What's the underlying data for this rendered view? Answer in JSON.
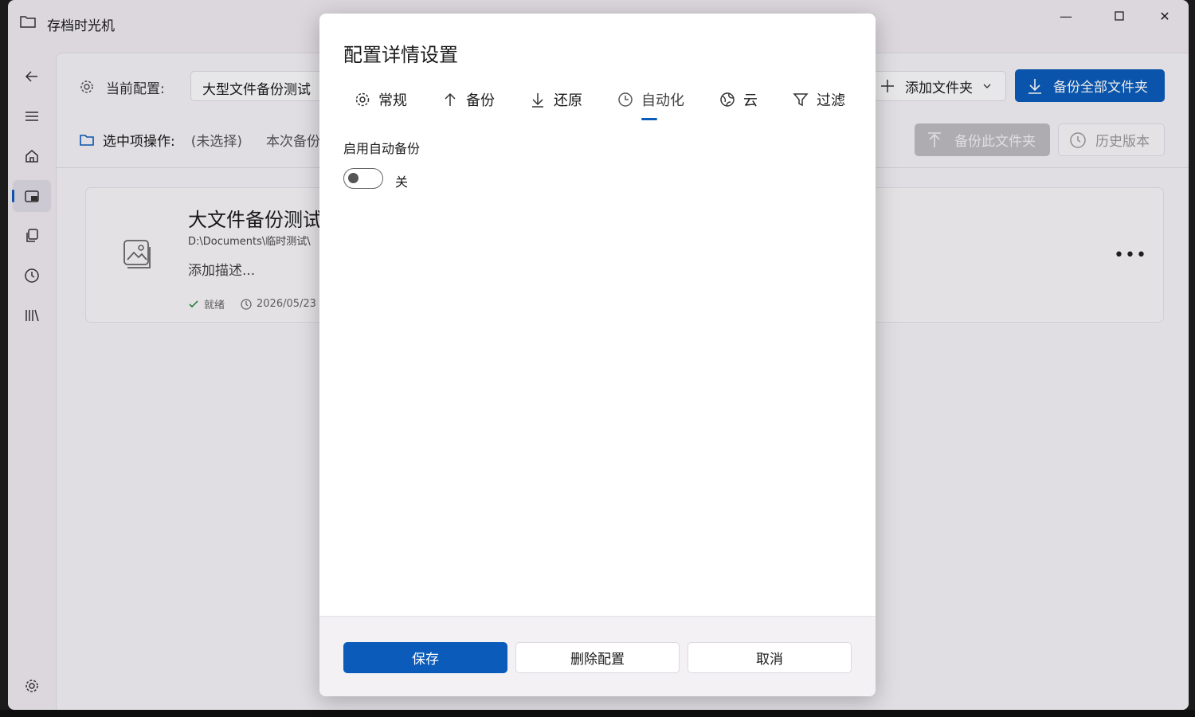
{
  "window": {
    "title": "存档时光机",
    "minimize_glyph": "—",
    "maximize_glyph": "☐",
    "close_glyph": "✕"
  },
  "toolbar": {
    "current_config_label": "当前配置:",
    "current_config_value": "大型文件备份测试",
    "add_folder_label": "添加文件夹",
    "backup_all_label": "备份全部文件夹"
  },
  "selection_bar": {
    "label": "选中项操作:",
    "selection_value": "(未选择)",
    "this_backup_label": "本次备份",
    "backup_this_label": "备份此文件夹",
    "history_label": "历史版本"
  },
  "card": {
    "title": "大文件备份测试",
    "path": "D:\\Documents\\临时测试\\",
    "description": "添加描述...",
    "status": "就绪",
    "timestamp": "2026/05/23",
    "more_glyph": "•••"
  },
  "dialog": {
    "title": "配置详情设置",
    "tabs": [
      {
        "label": "常规",
        "icon": "gear-icon"
      },
      {
        "label": "备份",
        "icon": "arrow-up-icon"
      },
      {
        "label": "还原",
        "icon": "arrow-down-icon"
      },
      {
        "label": "自动化",
        "icon": "clock-icon"
      },
      {
        "label": "云",
        "icon": "globe-icon"
      },
      {
        "label": "过滤",
        "icon": "filter-icon"
      }
    ],
    "active_tab": "自动化",
    "auto_backup_label": "启用自动备份",
    "auto_backup_enabled": false,
    "toggle_state_text": "关",
    "save_label": "保存",
    "delete_label": "删除配置",
    "cancel_label": "取消"
  },
  "colors": {
    "accent": "#0b5cba",
    "window_bg": "#eeeaf0",
    "dialog_bg": "#ffffff"
  }
}
